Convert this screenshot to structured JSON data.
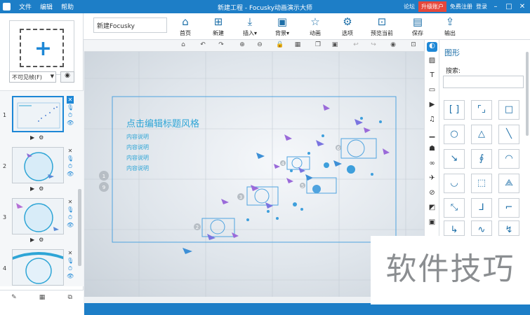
{
  "titlebar": {
    "menu": [
      "文件",
      "编辑",
      "帮助"
    ],
    "title": "新建工程 - Focusky动画演示大师",
    "forum": "论坛",
    "upgrade": "升级账户",
    "register": "免费注册",
    "login": "登录"
  },
  "toolbar": {
    "project_name": "新建Focusky",
    "buttons": {
      "home": "首页",
      "new": "新建",
      "insert": "插入",
      "background": "背景",
      "animation": "动画",
      "options": "选项",
      "preview": "预览当前",
      "save": "保存",
      "export": "输出"
    }
  },
  "left": {
    "visibility": "不可见帧(F)",
    "slides": [
      {
        "num": "1"
      },
      {
        "num": "2"
      },
      {
        "num": "3"
      },
      {
        "num": "4"
      }
    ]
  },
  "canvas": {
    "title": "点击编辑标题风格",
    "items": [
      "内容说明",
      "内容说明",
      "内容说明",
      "内容说明"
    ],
    "badges": [
      "1",
      "9",
      "2",
      "3",
      "4",
      "5",
      "6"
    ]
  },
  "panel": {
    "heading": "图形",
    "search_label": "搜索:"
  },
  "watermark": "软件技巧",
  "colors": {
    "accent": "#1d7ec7",
    "upgrade": "#e6473a",
    "text_accent": "#2ea5d6"
  }
}
